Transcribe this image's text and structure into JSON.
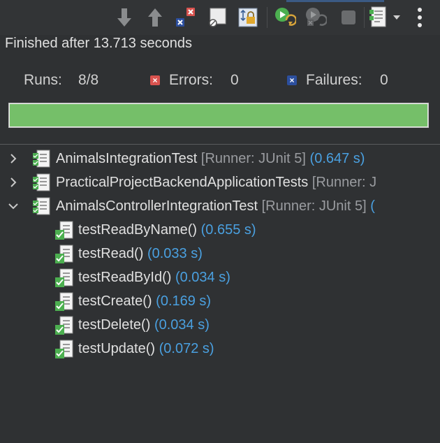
{
  "status": {
    "text": "Finished after 13.713 seconds"
  },
  "counters": {
    "runs_label": "Runs:",
    "runs_value": "8/8",
    "errors_label": "Errors:",
    "errors_value": "0",
    "failures_label": "Failures:",
    "failures_value": "0"
  },
  "progress": {
    "fraction": 1.0,
    "color": "#75bf69"
  },
  "toolbar": {
    "icons": [
      "next-failure-icon",
      "previous-failure-icon",
      "show-failures-only-icon",
      "show-skipped-only-icon",
      "scroll-lock-icon",
      "rerun-test-icon",
      "rerun-failed-first-icon",
      "stop-icon",
      "test-run-history-icon",
      "history-dropdown-icon",
      "view-menu-icon"
    ]
  },
  "tree": {
    "suites": [
      {
        "name": "AnimalsIntegrationTest",
        "runner": "[Runner: JUnit 5]",
        "time": "(0.647 s)",
        "expanded": false
      },
      {
        "name": "PracticalProjectBackendApplicationTests",
        "runner": "[Runner: J",
        "time": "",
        "expanded": false
      },
      {
        "name": "AnimalsControllerIntegrationTest",
        "runner": "[Runner: JUnit 5]",
        "time": "(",
        "expanded": true
      }
    ],
    "tests": [
      {
        "name": "testReadByName()",
        "time": "(0.655 s)"
      },
      {
        "name": "testRead()",
        "time": "(0.033 s)"
      },
      {
        "name": "testReadById()",
        "time": "(0.034 s)"
      },
      {
        "name": "testCreate()",
        "time": "(0.169 s)"
      },
      {
        "name": "testDelete()",
        "time": "(0.034 s)"
      },
      {
        "name": "testUpdate()",
        "time": "(0.072 s)"
      }
    ]
  },
  "colors": {
    "time": "#4aa0e0",
    "runner": "#9a9ca0",
    "error": "#d9534f",
    "failure": "#2c4f9e"
  }
}
